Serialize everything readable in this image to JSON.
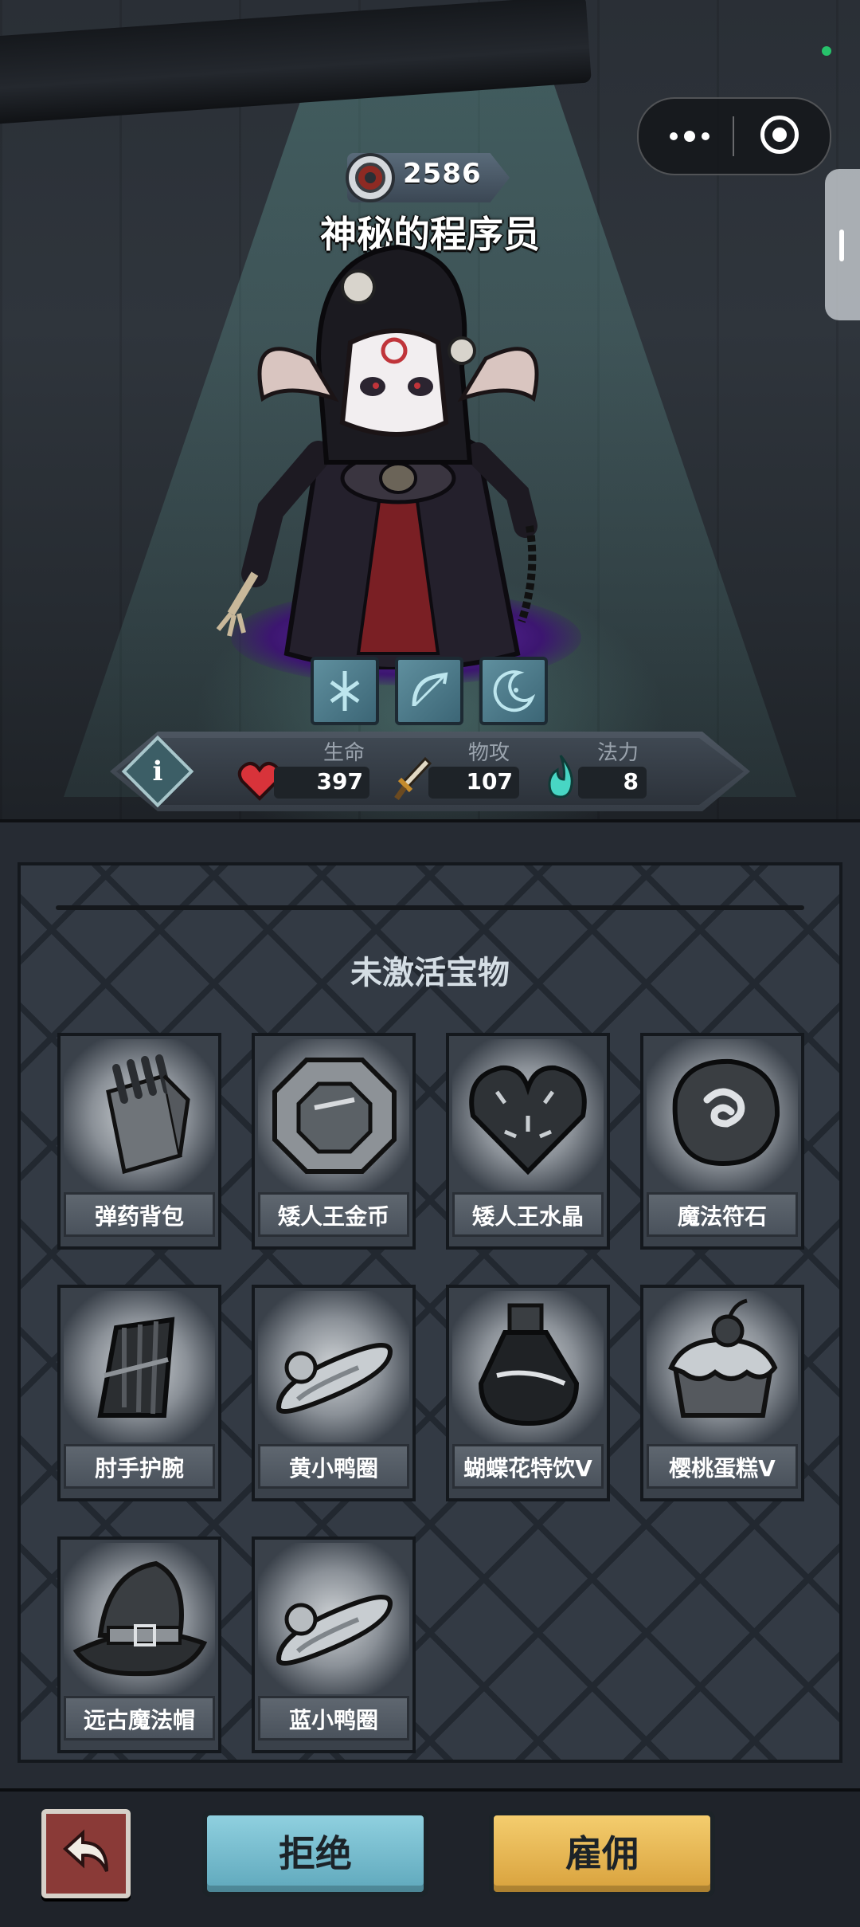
{
  "hero": {
    "power": "2586",
    "name": "神秘的程序员",
    "stats": {
      "hp_label": "生命",
      "hp_value": "397",
      "atk_label": "物攻",
      "atk_value": "107",
      "mp_label": "法力",
      "mp_value": "8"
    },
    "skills": [
      "skill-rune-icon",
      "skill-bow-icon",
      "skill-moon-icon"
    ]
  },
  "treasures": {
    "title": "未激活宝物",
    "items": [
      {
        "label": "弹药背包",
        "icon": "ammo-bag-icon"
      },
      {
        "label": "矮人王金币",
        "icon": "dwarf-coin-icon"
      },
      {
        "label": "矮人王水晶",
        "icon": "dwarf-crystal-icon"
      },
      {
        "label": "魔法符石",
        "icon": "magic-rune-stone-icon"
      },
      {
        "label": "肘手护腕",
        "icon": "bracer-icon"
      },
      {
        "label": "黄小鸭圈",
        "icon": "yellow-duck-ring-icon"
      },
      {
        "label": "蝴蝶花特饮V",
        "icon": "potion-icon"
      },
      {
        "label": "樱桃蛋糕V",
        "icon": "cherry-cake-icon"
      },
      {
        "label": "远古魔法帽",
        "icon": "ancient-magic-hat-icon"
      },
      {
        "label": "蓝小鸭圈",
        "icon": "blue-duck-ring-icon"
      }
    ]
  },
  "actions": {
    "reject": "拒绝",
    "hire": "雇佣"
  },
  "colors": {
    "reject_button": "#7cc0d2",
    "hire_button": "#e8b955",
    "back_button": "#8a3a37"
  }
}
